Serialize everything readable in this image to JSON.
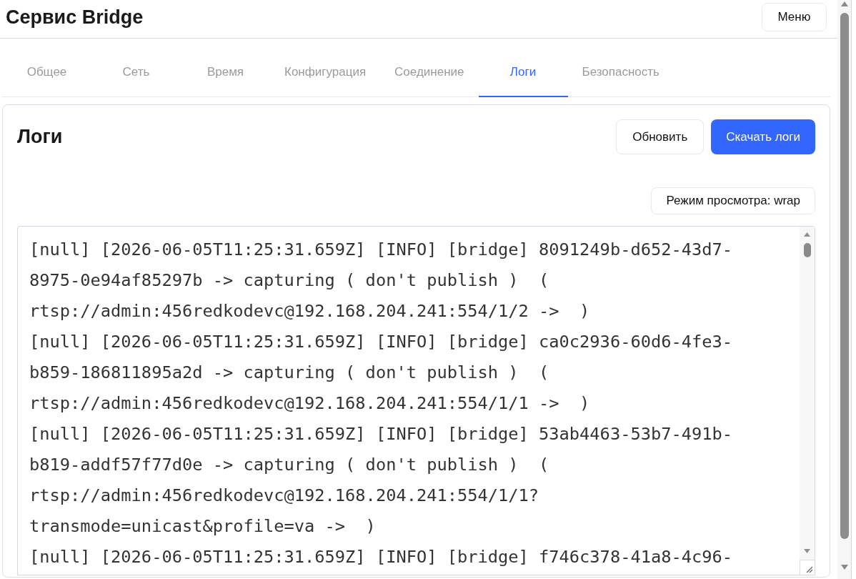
{
  "header": {
    "title": "Сервис Bridge",
    "menu_button": "Меню"
  },
  "tabs": [
    {
      "label": "Общее",
      "selected": false
    },
    {
      "label": "Сеть",
      "selected": false
    },
    {
      "label": "Время",
      "selected": false
    },
    {
      "label": "Конфигурация",
      "selected": false
    },
    {
      "label": "Соединение",
      "selected": false
    },
    {
      "label": "Логи",
      "selected": true
    },
    {
      "label": "Безопасность",
      "selected": false
    }
  ],
  "logs_panel": {
    "title": "Логи",
    "refresh_button": "Обновить",
    "download_button": "Скачать логи",
    "view_mode_button": "Режим просмотра: wrap",
    "entries": [
      "[null] [2026-06-05T11:25:31.659Z] [INFO] [bridge] 8091249b-d652-43d7-8975-0e94af85297b -> capturing ( don't publish )  ( rtsp://admin:456redkodevc@192.168.204.241:554/1/2 ->  )",
      "[null] [2026-06-05T11:25:31.659Z] [INFO] [bridge] ca0c2936-60d6-4fe3-b859-186811895a2d -> capturing ( don't publish )  ( rtsp://admin:456redkodevc@192.168.204.241:554/1/1 ->  )",
      "[null] [2026-06-05T11:25:31.659Z] [INFO] [bridge] 53ab4463-53b7-491b-b819-addf57f77d0e -> capturing ( don't publish )  ( rtsp://admin:456redkodevc@192.168.204.241:554/1/1?transmode=unicast&profile=va ->  )",
      "[null] [2026-06-05T11:25:31.659Z] [INFO] [bridge] f746c378-41a8-4c96-"
    ]
  }
}
